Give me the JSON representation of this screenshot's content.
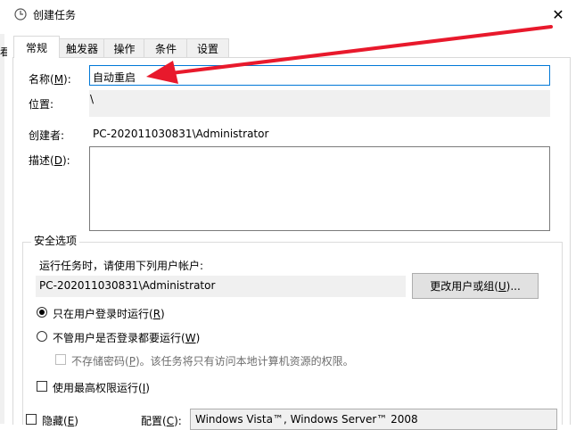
{
  "window": {
    "title": "创建任务",
    "close_glyph": "✕",
    "left_fragment": "看"
  },
  "tabs": [
    {
      "label": "常规"
    },
    {
      "label": "触发器"
    },
    {
      "label": "操作"
    },
    {
      "label": "条件"
    },
    {
      "label": "设置"
    }
  ],
  "general": {
    "name_label": "名称(",
    "name_key": "M",
    "name_suffix": "):",
    "name_value": "自动重启",
    "location_label": "位置:",
    "location_value": "\\",
    "author_label": "创建者:",
    "author_value": "PC-202011030831\\Administrator",
    "desc_label": "描述(",
    "desc_key": "D",
    "desc_suffix": "):",
    "desc_value": ""
  },
  "security": {
    "title": "安全选项",
    "run_as_label": "运行任务时，请使用下列用户帐户:",
    "account_value": "PC-202011030831\\Administrator",
    "change_btn_prefix": "更改用户或组(",
    "change_btn_key": "U",
    "change_btn_suffix": ")...",
    "radio1_prefix": "只在用户登录时运行(",
    "radio1_key": "R",
    "radio1_suffix": ")",
    "radio2_prefix": "不管用户是否登录都要运行(",
    "radio2_key": "W",
    "radio2_suffix": ")",
    "nostore_prefix": "不存储密码(",
    "nostore_key": "P",
    "nostore_suffix": ")。该任务将只有访问本地计算机资源的权限。",
    "highest_prefix": "使用最高权限运行(",
    "highest_key": "I",
    "highest_suffix": ")"
  },
  "bottom": {
    "hidden_prefix": "隐藏(",
    "hidden_key": "E",
    "hidden_suffix": ")",
    "config_prefix": "配置(",
    "config_key": "C",
    "config_suffix": "):",
    "config_value": "Windows Vista™, Windows Server™ 2008"
  },
  "colors": {
    "arrow": "#e8192c",
    "focus_border": "#0078d7"
  },
  "icons": {
    "title": "clock-icon",
    "close": "close-icon",
    "arrow": "red-arrow-annotation"
  }
}
